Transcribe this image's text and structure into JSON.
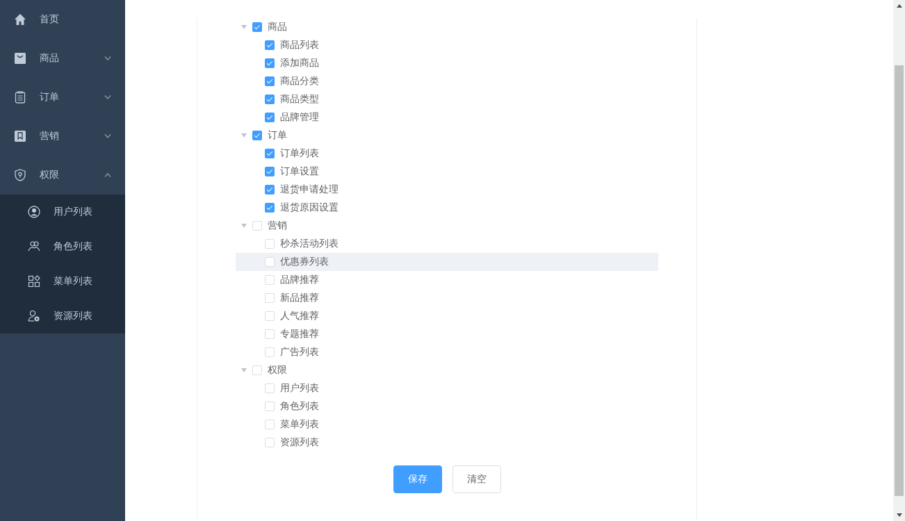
{
  "sidebar": {
    "items": [
      {
        "label": "首页",
        "kind": "link"
      },
      {
        "label": "商品",
        "kind": "submenu",
        "expanded": false
      },
      {
        "label": "订单",
        "kind": "submenu",
        "expanded": false
      },
      {
        "label": "营销",
        "kind": "submenu",
        "expanded": false
      },
      {
        "label": "权限",
        "kind": "submenu",
        "expanded": true,
        "children": [
          {
            "label": "用户列表"
          },
          {
            "label": "角色列表"
          },
          {
            "label": "菜单列表"
          },
          {
            "label": "资源列表"
          }
        ]
      }
    ]
  },
  "tree": [
    {
      "label": "商品",
      "checked": true,
      "expanded": true,
      "highlighted": false,
      "children": [
        {
          "label": "商品列表",
          "checked": true,
          "highlighted": false
        },
        {
          "label": "添加商品",
          "checked": true,
          "highlighted": false
        },
        {
          "label": "商品分类",
          "checked": true,
          "highlighted": false
        },
        {
          "label": "商品类型",
          "checked": true,
          "highlighted": false
        },
        {
          "label": "品牌管理",
          "checked": true,
          "highlighted": false
        }
      ]
    },
    {
      "label": "订单",
      "checked": true,
      "expanded": true,
      "highlighted": false,
      "children": [
        {
          "label": "订单列表",
          "checked": true,
          "highlighted": false
        },
        {
          "label": "订单设置",
          "checked": true,
          "highlighted": false
        },
        {
          "label": "退货申请处理",
          "checked": true,
          "highlighted": false
        },
        {
          "label": "退货原因设置",
          "checked": true,
          "highlighted": false
        }
      ]
    },
    {
      "label": "营销",
      "checked": false,
      "expanded": true,
      "highlighted": false,
      "children": [
        {
          "label": "秒杀活动列表",
          "checked": false,
          "highlighted": false
        },
        {
          "label": "优惠券列表",
          "checked": false,
          "highlighted": true
        },
        {
          "label": "品牌推荐",
          "checked": false,
          "highlighted": false
        },
        {
          "label": "新品推荐",
          "checked": false,
          "highlighted": false
        },
        {
          "label": "人气推荐",
          "checked": false,
          "highlighted": false
        },
        {
          "label": "专题推荐",
          "checked": false,
          "highlighted": false
        },
        {
          "label": "广告列表",
          "checked": false,
          "highlighted": false
        }
      ]
    },
    {
      "label": "权限",
      "checked": false,
      "expanded": true,
      "highlighted": false,
      "children": [
        {
          "label": "用户列表",
          "checked": false,
          "highlighted": false
        },
        {
          "label": "角色列表",
          "checked": false,
          "highlighted": false
        },
        {
          "label": "菜单列表",
          "checked": false,
          "highlighted": false
        },
        {
          "label": "资源列表",
          "checked": false,
          "highlighted": false
        }
      ]
    }
  ],
  "buttons": [
    {
      "label": "保存",
      "kind": "primary"
    },
    {
      "label": "清空",
      "kind": "default"
    }
  ]
}
